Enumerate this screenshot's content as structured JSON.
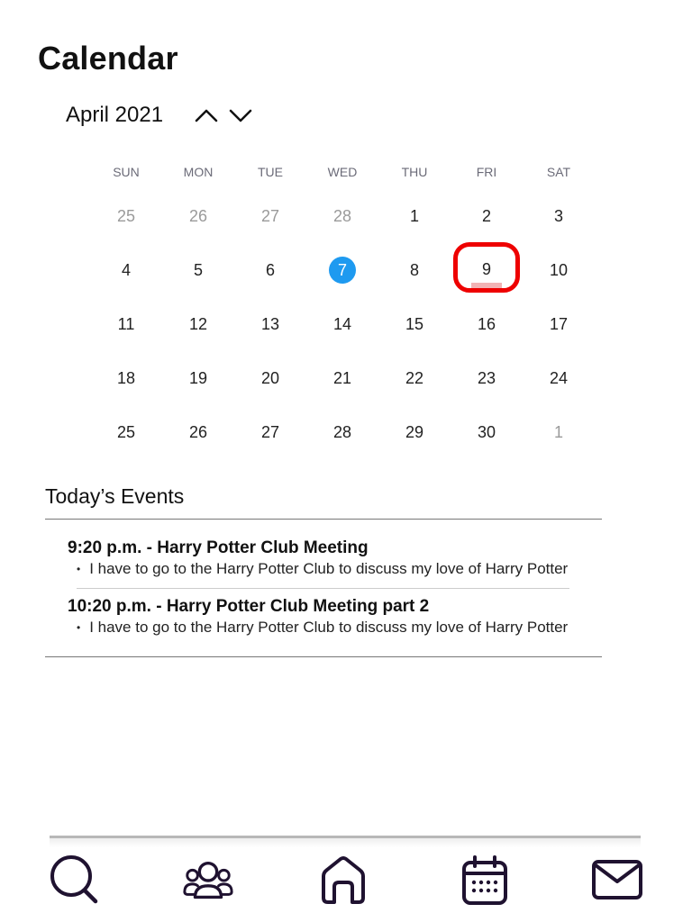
{
  "page": {
    "title": "Calendar"
  },
  "calendar": {
    "month_label": "April 2021",
    "prev_icon": "chevron-up-icon",
    "next_icon": "chevron-down-icon",
    "weekdays": [
      "SUN",
      "MON",
      "TUE",
      "WED",
      "THU",
      "FRI",
      "SAT"
    ],
    "weeks": [
      [
        {
          "d": "25",
          "muted": true
        },
        {
          "d": "26",
          "muted": true
        },
        {
          "d": "27",
          "muted": true
        },
        {
          "d": "28",
          "muted": true
        },
        {
          "d": "1"
        },
        {
          "d": "2"
        },
        {
          "d": "3"
        }
      ],
      [
        {
          "d": "4"
        },
        {
          "d": "5"
        },
        {
          "d": "6"
        },
        {
          "d": "7",
          "today": true
        },
        {
          "d": "8"
        },
        {
          "d": "9",
          "selected": true,
          "has_event": true
        },
        {
          "d": "10"
        }
      ],
      [
        {
          "d": "11"
        },
        {
          "d": "12"
        },
        {
          "d": "13"
        },
        {
          "d": "14"
        },
        {
          "d": "15"
        },
        {
          "d": "16"
        },
        {
          "d": "17"
        }
      ],
      [
        {
          "d": "18"
        },
        {
          "d": "19"
        },
        {
          "d": "20"
        },
        {
          "d": "21"
        },
        {
          "d": "22"
        },
        {
          "d": "23"
        },
        {
          "d": "24"
        }
      ],
      [
        {
          "d": "25"
        },
        {
          "d": "26"
        },
        {
          "d": "27"
        },
        {
          "d": "28"
        },
        {
          "d": "29"
        },
        {
          "d": "30"
        },
        {
          "d": "1",
          "muted": true
        }
      ]
    ],
    "colors": {
      "today_fill": "#1e9af0",
      "selected_ring": "#ee0000",
      "event_marker": "#f2b3b5"
    }
  },
  "events": {
    "title": "Today’s Events",
    "items": [
      {
        "heading": "9:20 p.m. - Harry Potter Club Meeting",
        "description": "I have to go to the Harry Potter Club to discuss my love of Harry Potter"
      },
      {
        "heading": "10:20 p.m. - Harry Potter Club Meeting part 2",
        "description": "I have to go to the Harry Potter Club to discuss my love of Harry Potter"
      }
    ]
  },
  "bottom_nav": {
    "icon_color": "#1f1230",
    "items": [
      {
        "icon": "search-icon"
      },
      {
        "icon": "people-icon"
      },
      {
        "icon": "home-icon"
      },
      {
        "icon": "calendar-icon"
      },
      {
        "icon": "mail-icon"
      }
    ]
  }
}
